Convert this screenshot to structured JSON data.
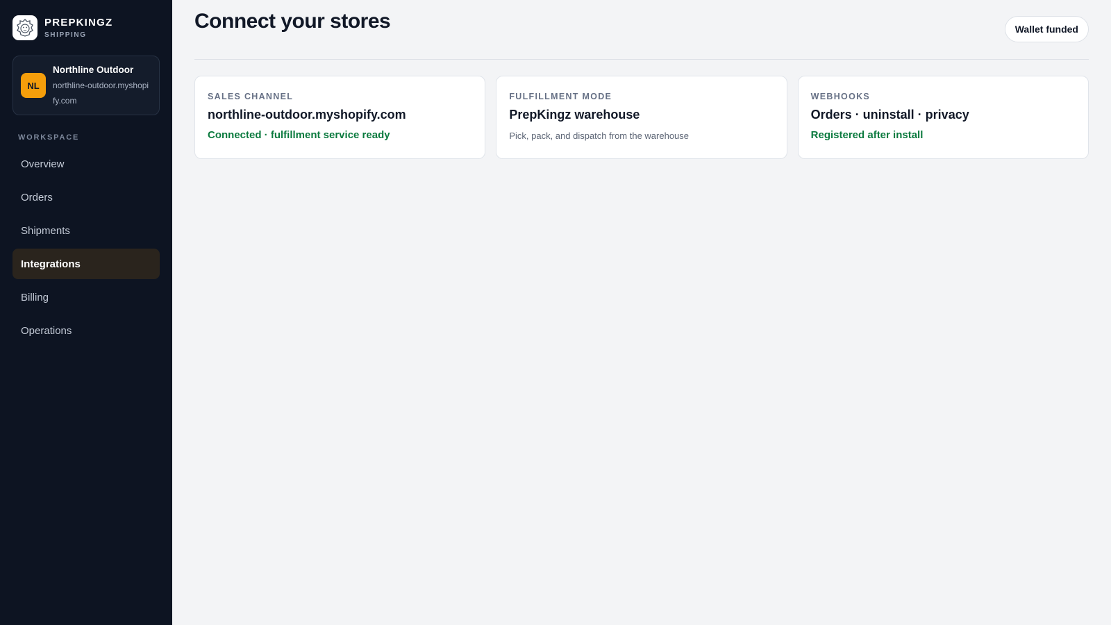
{
  "brand": {
    "name": "PREPKINGZ",
    "subtitle": "SHIPPING",
    "logo_icon": "lion-icon"
  },
  "store": {
    "initials": "NL",
    "name": "Northline Outdoor",
    "domain": "northline-outdoor.myshopify.com",
    "avatar_color": "#f59e0b"
  },
  "sidebar": {
    "section_label": "WORKSPACE",
    "items": [
      {
        "label": "Overview"
      },
      {
        "label": "Orders"
      },
      {
        "label": "Shipments"
      },
      {
        "label": "Integrations",
        "active": true
      },
      {
        "label": "Billing"
      },
      {
        "label": "Operations"
      }
    ]
  },
  "header": {
    "title": "Connect your stores",
    "wallet_badge": "Wallet funded"
  },
  "cards": [
    {
      "label": "SALES CHANNEL",
      "title": "northline-outdoor.myshopify.com",
      "status": "Connected · fulfillment service ready"
    },
    {
      "label": "FULFILLMENT MODE",
      "title": "PrepKingz warehouse",
      "description": "Pick, pack, and dispatch from the warehouse"
    },
    {
      "label": "WEBHOOKS",
      "title": "Orders · uninstall · privacy",
      "status": "Registered after install"
    }
  ],
  "colors": {
    "sidebar_bg": "#0d1422",
    "active_nav_bg": "#2a241d",
    "success_text": "#0a7a3e",
    "page_bg": "#f3f4f6"
  }
}
